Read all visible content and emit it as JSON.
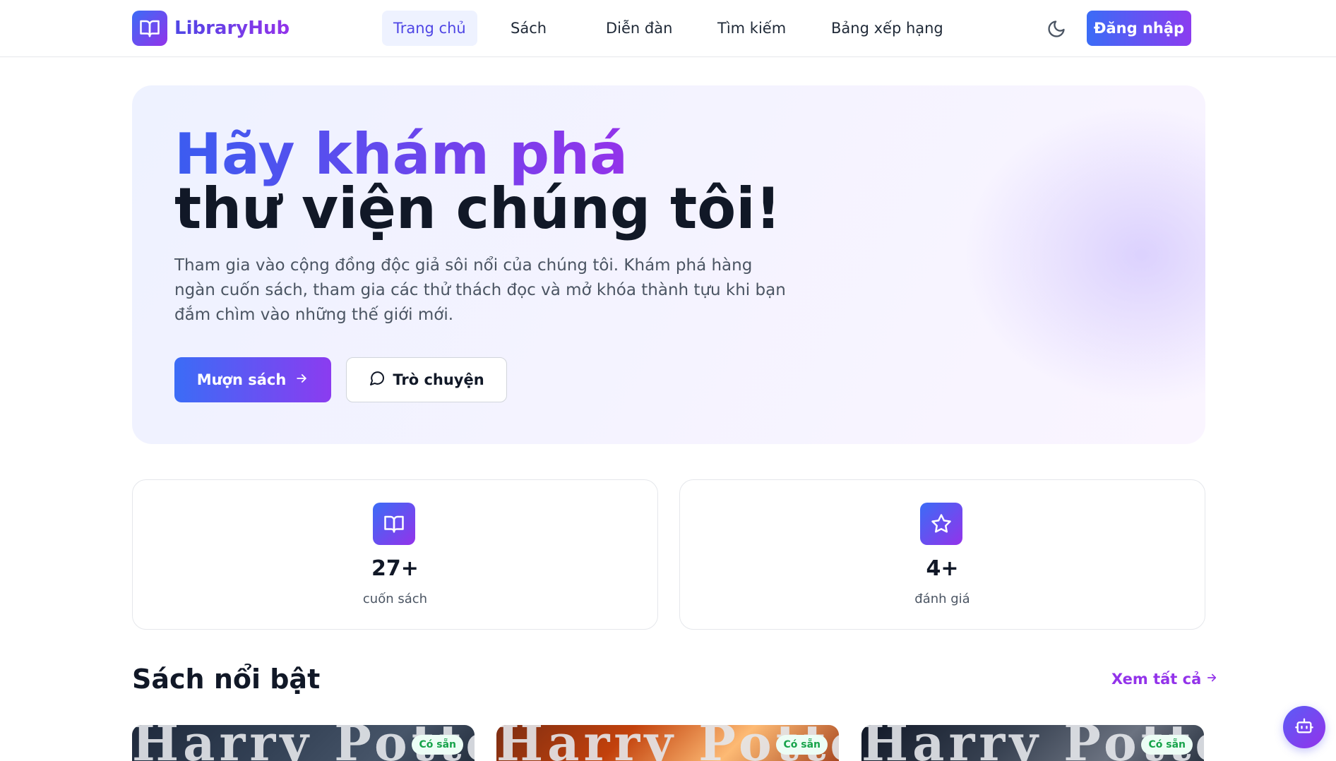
{
  "header": {
    "logo_text": "LibraryHub",
    "nav": [
      {
        "label": "Trang chủ",
        "active": true
      },
      {
        "label": "Sách",
        "active": false
      },
      {
        "label": "Diễn đàn",
        "active": false
      },
      {
        "label": "Tìm kiếm",
        "active": false
      },
      {
        "label": "Bảng xếp hạng",
        "active": false
      }
    ],
    "theme_icon": "moon-icon",
    "login_label": "Đăng nhập"
  },
  "hero": {
    "title_line1": "Hãy khám phá",
    "title_line2": "thư viện chúng tôi!",
    "description": "Tham gia vào cộng đồng độc giả sôi nổi của chúng tôi. Khám phá hàng ngàn cuốn sách, tham gia các thử thách đọc và mở khóa thành tựu khi bạn đắm chìm vào những thế giới mới.",
    "borrow_label": "Mượn sách",
    "chat_label": "Trò chuyện"
  },
  "stats": [
    {
      "icon": "book-open-icon",
      "value": "27+",
      "label": "cuốn sách"
    },
    {
      "icon": "star-icon",
      "value": "4+",
      "label": "đánh giá"
    }
  ],
  "featured": {
    "title": "Sách nổi bật",
    "see_all_label": "Xem tất cả",
    "books": [
      {
        "cover_text": "Harry Potter",
        "badge": "Có sẵn"
      },
      {
        "cover_text": "Harry Potter",
        "badge": "Có sẵn"
      },
      {
        "cover_text": "Harry Potter",
        "badge": "Có sẵn"
      }
    ]
  },
  "colors": {
    "accent_start": "#3b6cf6",
    "accent_end": "#9333ea",
    "available_badge": "#16a34a"
  }
}
